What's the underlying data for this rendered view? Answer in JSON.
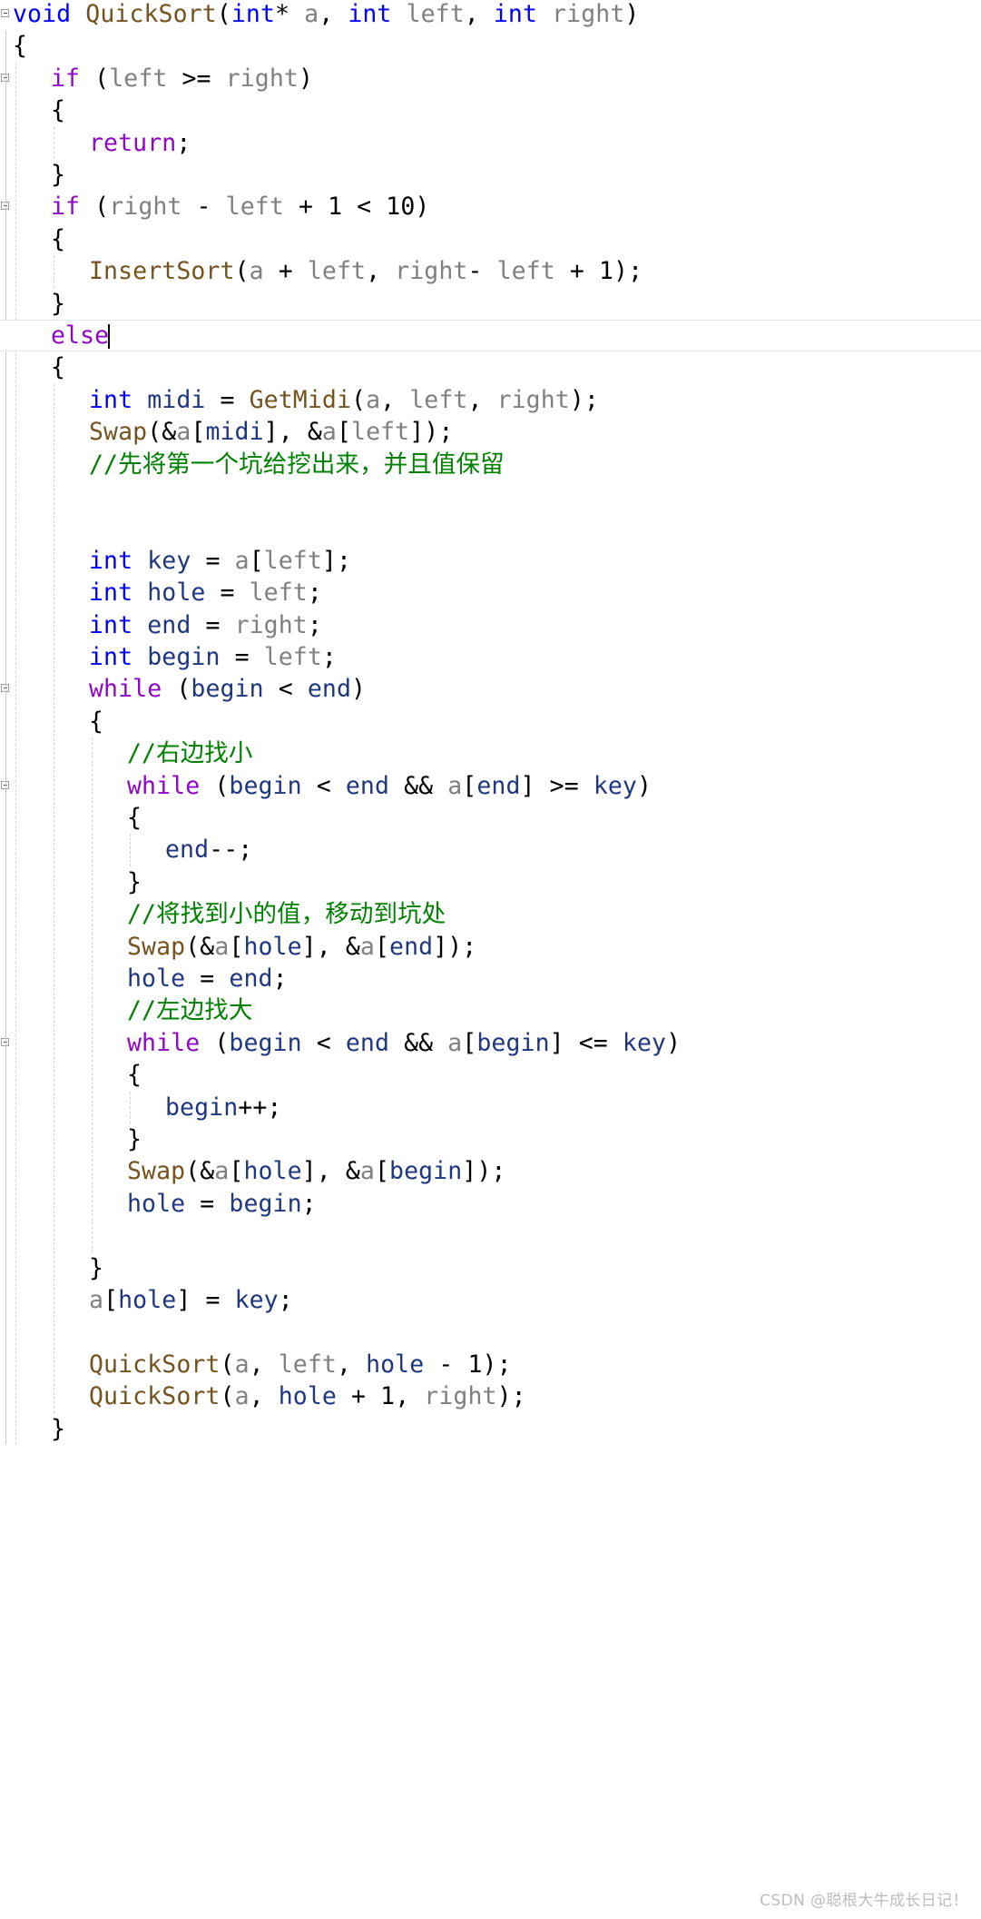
{
  "app": {
    "kind": "code-editor",
    "language": "C",
    "theme": "light"
  },
  "colors": {
    "background": "#ffffff",
    "keyword": "#8f08c4",
    "type": "#0000ff",
    "function": "#74531f",
    "parameter": "#808080",
    "local_variable": "#1f377f",
    "punctuation": "#000000",
    "comment": "#008000",
    "guide_line": "#d4d4d4",
    "current_line_border": "#e6e6ef",
    "watermark": "#bdbdbd"
  },
  "watermark": {
    "text": "CSDN @聪根大牛成长日记！"
  },
  "code": {
    "lines": [
      {
        "indent": 0,
        "fold": true,
        "tokens": [
          {
            "t": "void",
            "c": "type"
          },
          {
            "t": " ",
            "c": "punc"
          },
          {
            "t": "QuickSort",
            "c": "fn"
          },
          {
            "t": "(",
            "c": "punc"
          },
          {
            "t": "int",
            "c": "type"
          },
          {
            "t": "*",
            "c": "punc"
          },
          {
            "t": " ",
            "c": "punc"
          },
          {
            "t": "a",
            "c": "param"
          },
          {
            "t": ", ",
            "c": "punc"
          },
          {
            "t": "int",
            "c": "type"
          },
          {
            "t": " ",
            "c": "punc"
          },
          {
            "t": "left",
            "c": "param"
          },
          {
            "t": ", ",
            "c": "punc"
          },
          {
            "t": "int",
            "c": "type"
          },
          {
            "t": " ",
            "c": "punc"
          },
          {
            "t": "right",
            "c": "param"
          },
          {
            "t": ")",
            "c": "punc"
          }
        ]
      },
      {
        "indent": 0,
        "fold": false,
        "tokens": [
          {
            "t": "{",
            "c": "punc"
          }
        ]
      },
      {
        "indent": 1,
        "fold": true,
        "tokens": [
          {
            "t": "if",
            "c": "kw"
          },
          {
            "t": " (",
            "c": "punc"
          },
          {
            "t": "left",
            "c": "param"
          },
          {
            "t": " >= ",
            "c": "punc"
          },
          {
            "t": "right",
            "c": "param"
          },
          {
            "t": ")",
            "c": "punc"
          }
        ]
      },
      {
        "indent": 1,
        "fold": false,
        "tokens": [
          {
            "t": "{",
            "c": "punc"
          }
        ]
      },
      {
        "indent": 2,
        "fold": false,
        "tokens": [
          {
            "t": "return",
            "c": "kw"
          },
          {
            "t": ";",
            "c": "punc"
          }
        ]
      },
      {
        "indent": 1,
        "fold": false,
        "tokens": [
          {
            "t": "}",
            "c": "punc"
          }
        ]
      },
      {
        "indent": 1,
        "fold": true,
        "tokens": [
          {
            "t": "if",
            "c": "kw"
          },
          {
            "t": " (",
            "c": "punc"
          },
          {
            "t": "right",
            "c": "param"
          },
          {
            "t": " - ",
            "c": "punc"
          },
          {
            "t": "left",
            "c": "param"
          },
          {
            "t": " + ",
            "c": "punc"
          },
          {
            "t": "1",
            "c": "num"
          },
          {
            "t": " < ",
            "c": "punc"
          },
          {
            "t": "10",
            "c": "num"
          },
          {
            "t": ")",
            "c": "punc"
          }
        ]
      },
      {
        "indent": 1,
        "fold": false,
        "tokens": [
          {
            "t": "{",
            "c": "punc"
          }
        ]
      },
      {
        "indent": 2,
        "fold": false,
        "tokens": [
          {
            "t": "InsertSort",
            "c": "fn"
          },
          {
            "t": "(",
            "c": "punc"
          },
          {
            "t": "a",
            "c": "param"
          },
          {
            "t": " + ",
            "c": "punc"
          },
          {
            "t": "left",
            "c": "param"
          },
          {
            "t": ", ",
            "c": "punc"
          },
          {
            "t": "right",
            "c": "param"
          },
          {
            "t": "- ",
            "c": "punc"
          },
          {
            "t": "left",
            "c": "param"
          },
          {
            "t": " + ",
            "c": "punc"
          },
          {
            "t": "1",
            "c": "num"
          },
          {
            "t": ");",
            "c": "punc"
          }
        ]
      },
      {
        "indent": 1,
        "fold": false,
        "tokens": [
          {
            "t": "}",
            "c": "punc"
          }
        ]
      },
      {
        "indent": 1,
        "fold": true,
        "current": true,
        "caret": true,
        "tokens": [
          {
            "t": "else",
            "c": "kw"
          }
        ]
      },
      {
        "indent": 1,
        "fold": false,
        "tokens": [
          {
            "t": "{",
            "c": "punc"
          }
        ]
      },
      {
        "indent": 2,
        "fold": false,
        "tokens": [
          {
            "t": "int",
            "c": "type"
          },
          {
            "t": " ",
            "c": "punc"
          },
          {
            "t": "midi",
            "c": "local"
          },
          {
            "t": " = ",
            "c": "punc"
          },
          {
            "t": "GetMidi",
            "c": "fn"
          },
          {
            "t": "(",
            "c": "punc"
          },
          {
            "t": "a",
            "c": "param"
          },
          {
            "t": ", ",
            "c": "punc"
          },
          {
            "t": "left",
            "c": "param"
          },
          {
            "t": ", ",
            "c": "punc"
          },
          {
            "t": "right",
            "c": "param"
          },
          {
            "t": ");",
            "c": "punc"
          }
        ]
      },
      {
        "indent": 2,
        "fold": false,
        "tokens": [
          {
            "t": "Swap",
            "c": "fn"
          },
          {
            "t": "(&",
            "c": "punc"
          },
          {
            "t": "a",
            "c": "param"
          },
          {
            "t": "[",
            "c": "punc"
          },
          {
            "t": "midi",
            "c": "local"
          },
          {
            "t": "], &",
            "c": "punc"
          },
          {
            "t": "a",
            "c": "param"
          },
          {
            "t": "[",
            "c": "punc"
          },
          {
            "t": "left",
            "c": "param"
          },
          {
            "t": "]);",
            "c": "punc"
          }
        ]
      },
      {
        "indent": 2,
        "fold": false,
        "tokens": [
          {
            "t": "//先将第一个坑给挖出来，并且值保留",
            "c": "cmt"
          }
        ]
      },
      {
        "indent": 0,
        "fold": false,
        "tokens": []
      },
      {
        "indent": 0,
        "fold": false,
        "tokens": []
      },
      {
        "indent": 2,
        "fold": false,
        "tokens": [
          {
            "t": "int",
            "c": "type"
          },
          {
            "t": " ",
            "c": "punc"
          },
          {
            "t": "key",
            "c": "local"
          },
          {
            "t": " = ",
            "c": "punc"
          },
          {
            "t": "a",
            "c": "param"
          },
          {
            "t": "[",
            "c": "punc"
          },
          {
            "t": "left",
            "c": "param"
          },
          {
            "t": "];",
            "c": "punc"
          }
        ]
      },
      {
        "indent": 2,
        "fold": false,
        "tokens": [
          {
            "t": "int",
            "c": "type"
          },
          {
            "t": " ",
            "c": "punc"
          },
          {
            "t": "hole",
            "c": "local"
          },
          {
            "t": " = ",
            "c": "punc"
          },
          {
            "t": "left",
            "c": "param"
          },
          {
            "t": ";",
            "c": "punc"
          }
        ]
      },
      {
        "indent": 2,
        "fold": false,
        "tokens": [
          {
            "t": "int",
            "c": "type"
          },
          {
            "t": " ",
            "c": "punc"
          },
          {
            "t": "end",
            "c": "local"
          },
          {
            "t": " = ",
            "c": "punc"
          },
          {
            "t": "right",
            "c": "param"
          },
          {
            "t": ";",
            "c": "punc"
          }
        ]
      },
      {
        "indent": 2,
        "fold": false,
        "tokens": [
          {
            "t": "int",
            "c": "type"
          },
          {
            "t": " ",
            "c": "punc"
          },
          {
            "t": "begin",
            "c": "local"
          },
          {
            "t": " = ",
            "c": "punc"
          },
          {
            "t": "left",
            "c": "param"
          },
          {
            "t": ";",
            "c": "punc"
          }
        ]
      },
      {
        "indent": 2,
        "fold": true,
        "tokens": [
          {
            "t": "while",
            "c": "kw"
          },
          {
            "t": " (",
            "c": "punc"
          },
          {
            "t": "begin",
            "c": "local"
          },
          {
            "t": " < ",
            "c": "punc"
          },
          {
            "t": "end",
            "c": "local"
          },
          {
            "t": ")",
            "c": "punc"
          }
        ]
      },
      {
        "indent": 2,
        "fold": false,
        "tokens": [
          {
            "t": "{",
            "c": "punc"
          }
        ]
      },
      {
        "indent": 3,
        "fold": false,
        "tokens": [
          {
            "t": "//右边找小",
            "c": "cmt"
          }
        ]
      },
      {
        "indent": 3,
        "fold": true,
        "tokens": [
          {
            "t": "while",
            "c": "kw"
          },
          {
            "t": " (",
            "c": "punc"
          },
          {
            "t": "begin",
            "c": "local"
          },
          {
            "t": " < ",
            "c": "punc"
          },
          {
            "t": "end",
            "c": "local"
          },
          {
            "t": " && ",
            "c": "punc"
          },
          {
            "t": "a",
            "c": "param"
          },
          {
            "t": "[",
            "c": "punc"
          },
          {
            "t": "end",
            "c": "local"
          },
          {
            "t": "] >= ",
            "c": "punc"
          },
          {
            "t": "key",
            "c": "local"
          },
          {
            "t": ")",
            "c": "punc"
          }
        ]
      },
      {
        "indent": 3,
        "fold": false,
        "tokens": [
          {
            "t": "{",
            "c": "punc"
          }
        ]
      },
      {
        "indent": 4,
        "fold": false,
        "tokens": [
          {
            "t": "end",
            "c": "local"
          },
          {
            "t": "--;",
            "c": "punc"
          }
        ]
      },
      {
        "indent": 3,
        "fold": false,
        "tokens": [
          {
            "t": "}",
            "c": "punc"
          }
        ]
      },
      {
        "indent": 3,
        "fold": false,
        "tokens": [
          {
            "t": "//将找到小的值，移动到坑处",
            "c": "cmt"
          }
        ]
      },
      {
        "indent": 3,
        "fold": false,
        "tokens": [
          {
            "t": "Swap",
            "c": "fn"
          },
          {
            "t": "(&",
            "c": "punc"
          },
          {
            "t": "a",
            "c": "param"
          },
          {
            "t": "[",
            "c": "punc"
          },
          {
            "t": "hole",
            "c": "local"
          },
          {
            "t": "], &",
            "c": "punc"
          },
          {
            "t": "a",
            "c": "param"
          },
          {
            "t": "[",
            "c": "punc"
          },
          {
            "t": "end",
            "c": "local"
          },
          {
            "t": "]);",
            "c": "punc"
          }
        ]
      },
      {
        "indent": 3,
        "fold": false,
        "tokens": [
          {
            "t": "hole",
            "c": "local"
          },
          {
            "t": " = ",
            "c": "punc"
          },
          {
            "t": "end",
            "c": "local"
          },
          {
            "t": ";",
            "c": "punc"
          }
        ]
      },
      {
        "indent": 3,
        "fold": false,
        "tokens": [
          {
            "t": "//左边找大",
            "c": "cmt"
          }
        ]
      },
      {
        "indent": 3,
        "fold": true,
        "tokens": [
          {
            "t": "while",
            "c": "kw"
          },
          {
            "t": " (",
            "c": "punc"
          },
          {
            "t": "begin",
            "c": "local"
          },
          {
            "t": " < ",
            "c": "punc"
          },
          {
            "t": "end",
            "c": "local"
          },
          {
            "t": " && ",
            "c": "punc"
          },
          {
            "t": "a",
            "c": "param"
          },
          {
            "t": "[",
            "c": "punc"
          },
          {
            "t": "begin",
            "c": "local"
          },
          {
            "t": "] <= ",
            "c": "punc"
          },
          {
            "t": "key",
            "c": "local"
          },
          {
            "t": ")",
            "c": "punc"
          }
        ]
      },
      {
        "indent": 3,
        "fold": false,
        "tokens": [
          {
            "t": "{",
            "c": "punc"
          }
        ]
      },
      {
        "indent": 4,
        "fold": false,
        "tokens": [
          {
            "t": "begin",
            "c": "local"
          },
          {
            "t": "++;",
            "c": "punc"
          }
        ]
      },
      {
        "indent": 3,
        "fold": false,
        "tokens": [
          {
            "t": "}",
            "c": "punc"
          }
        ]
      },
      {
        "indent": 3,
        "fold": false,
        "tokens": [
          {
            "t": "Swap",
            "c": "fn"
          },
          {
            "t": "(&",
            "c": "punc"
          },
          {
            "t": "a",
            "c": "param"
          },
          {
            "t": "[",
            "c": "punc"
          },
          {
            "t": "hole",
            "c": "local"
          },
          {
            "t": "], &",
            "c": "punc"
          },
          {
            "t": "a",
            "c": "param"
          },
          {
            "t": "[",
            "c": "punc"
          },
          {
            "t": "begin",
            "c": "local"
          },
          {
            "t": "]);",
            "c": "punc"
          }
        ]
      },
      {
        "indent": 3,
        "fold": false,
        "tokens": [
          {
            "t": "hole",
            "c": "local"
          },
          {
            "t": " = ",
            "c": "punc"
          },
          {
            "t": "begin",
            "c": "local"
          },
          {
            "t": ";",
            "c": "punc"
          }
        ]
      },
      {
        "indent": 0,
        "fold": false,
        "tokens": []
      },
      {
        "indent": 2,
        "fold": false,
        "tokens": [
          {
            "t": "}",
            "c": "punc"
          }
        ]
      },
      {
        "indent": 2,
        "fold": false,
        "tokens": [
          {
            "t": "a",
            "c": "param"
          },
          {
            "t": "[",
            "c": "punc"
          },
          {
            "t": "hole",
            "c": "local"
          },
          {
            "t": "] = ",
            "c": "punc"
          },
          {
            "t": "key",
            "c": "local"
          },
          {
            "t": ";",
            "c": "punc"
          }
        ]
      },
      {
        "indent": 0,
        "fold": false,
        "tokens": []
      },
      {
        "indent": 2,
        "fold": false,
        "tokens": [
          {
            "t": "QuickSort",
            "c": "fn"
          },
          {
            "t": "(",
            "c": "punc"
          },
          {
            "t": "a",
            "c": "param"
          },
          {
            "t": ", ",
            "c": "punc"
          },
          {
            "t": "left",
            "c": "param"
          },
          {
            "t": ", ",
            "c": "punc"
          },
          {
            "t": "hole",
            "c": "local"
          },
          {
            "t": " - ",
            "c": "punc"
          },
          {
            "t": "1",
            "c": "num"
          },
          {
            "t": ");",
            "c": "punc"
          }
        ]
      },
      {
        "indent": 2,
        "fold": false,
        "tokens": [
          {
            "t": "QuickSort",
            "c": "fn"
          },
          {
            "t": "(",
            "c": "punc"
          },
          {
            "t": "a",
            "c": "param"
          },
          {
            "t": ", ",
            "c": "punc"
          },
          {
            "t": "hole",
            "c": "local"
          },
          {
            "t": " + ",
            "c": "punc"
          },
          {
            "t": "1",
            "c": "num"
          },
          {
            "t": ", ",
            "c": "punc"
          },
          {
            "t": "right",
            "c": "param"
          },
          {
            "t": ");",
            "c": "punc"
          }
        ]
      },
      {
        "indent": 1,
        "fold": false,
        "tokens": [
          {
            "t": "}",
            "c": "punc"
          }
        ]
      }
    ]
  }
}
